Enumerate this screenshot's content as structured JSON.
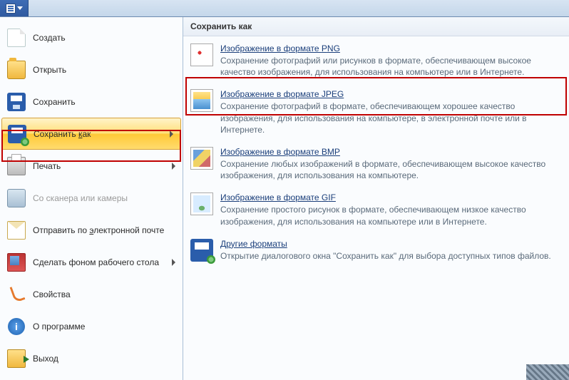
{
  "titlebar": {},
  "menu": {
    "items": [
      {
        "label": "Создать"
      },
      {
        "label": "Открыть"
      },
      {
        "label": "Сохранить"
      },
      {
        "label_pre": "Сохранить ",
        "label_u": "к",
        "label_post": "ак"
      },
      {
        "label": "Печать"
      },
      {
        "label": "Со сканера или камеры"
      },
      {
        "label_pre": "Отправить по ",
        "label_u": "э",
        "label_post": "лектронной почте"
      },
      {
        "label": "Сделать фоном рабочего стола"
      },
      {
        "label": "Свойства"
      },
      {
        "label": "О программе"
      },
      {
        "label": "Выход"
      }
    ]
  },
  "panel": {
    "header": "Сохранить как",
    "options": [
      {
        "title_pre": "Изображение в формате ",
        "title_u": "P",
        "title_post": "NG",
        "desc": "Сохранение фотографий или рисунков в формате, обеспечивающем высокое качество изображения, для использования на компьютере или в Интернете."
      },
      {
        "title_pre": "Изобра",
        "title_u": "ж",
        "title_post": "ение в формате JPEG",
        "desc": "Сохранение фотографий в формате, обеспечивающем хорошее качество изображения, для использования на компьютере, в электронной почте или в Интернете."
      },
      {
        "title_pre": "Изображение в формате ",
        "title_u": "B",
        "title_post": "MP",
        "desc": "Сохранение любых изображений в формате, обеспечивающем высокое качество изображения, для использования на компьютере."
      },
      {
        "title_pre": "Изображение в формате ",
        "title_u": "G",
        "title_post": "IF",
        "desc": "Сохранение простого рисунок в формате, обеспечивающем низкое качество изображения, для использования на компьютере или в Интернете."
      },
      {
        "title_pre": "",
        "title_u": "Д",
        "title_post": "ругие форматы",
        "desc": "Открытие диалогового окна \"Сохранить как\" для выбора доступных типов файлов."
      }
    ]
  },
  "info_glyph": "i"
}
